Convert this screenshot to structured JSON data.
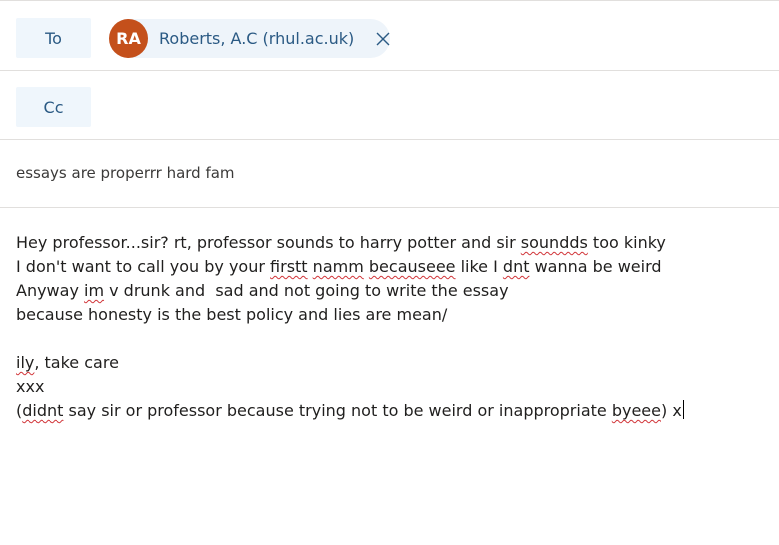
{
  "to_row": {
    "label": "To",
    "recipients": [
      {
        "initials": "RA",
        "name": "Roberts, A.C (rhul.ac.uk)",
        "avatar_color": "#c4501b",
        "remove_icon": "close-icon"
      }
    ]
  },
  "cc_row": {
    "label": "Cc"
  },
  "subject": "essays are properrr hard fam",
  "body": {
    "lines": [
      [
        {
          "t": "Hey professor...sir? rt, professor sounds to harry potter and sir "
        },
        {
          "t": "soundds",
          "spell": true
        },
        {
          "t": " too kinky"
        }
      ],
      [
        {
          "t": "I don't want to call you by your "
        },
        {
          "t": "firstt",
          "spell": true
        },
        {
          "t": " "
        },
        {
          "t": "namm",
          "spell": true
        },
        {
          "t": " "
        },
        {
          "t": "becauseee",
          "spell": true
        },
        {
          "t": " like I "
        },
        {
          "t": "dnt",
          "spell": true
        },
        {
          "t": " wanna be weird"
        }
      ],
      [
        {
          "t": "Anyway "
        },
        {
          "t": "im",
          "spell": true
        },
        {
          "t": " v drunk and  sad and not going to write the essay"
        }
      ],
      [
        {
          "t": "because honesty is the best policy and lies are mean/"
        }
      ],
      [],
      [
        {
          "t": "ily",
          "spell": true
        },
        {
          "t": ", take care"
        }
      ],
      [
        {
          "t": "xxx"
        }
      ],
      [
        {
          "t": "("
        },
        {
          "t": "didnt",
          "spell": true
        },
        {
          "t": " say sir or professor because trying not to be weird or inappropriate "
        },
        {
          "t": "byeee",
          "spell": true
        },
        {
          "t": ") x"
        }
      ]
    ],
    "spellcheck_color": "#d13438"
  },
  "colors": {
    "field_button_bg": "#eff6fc",
    "field_button_text": "#2b5a84",
    "chip_bg": "#eef4fa",
    "divider": "#e1dfdd"
  }
}
